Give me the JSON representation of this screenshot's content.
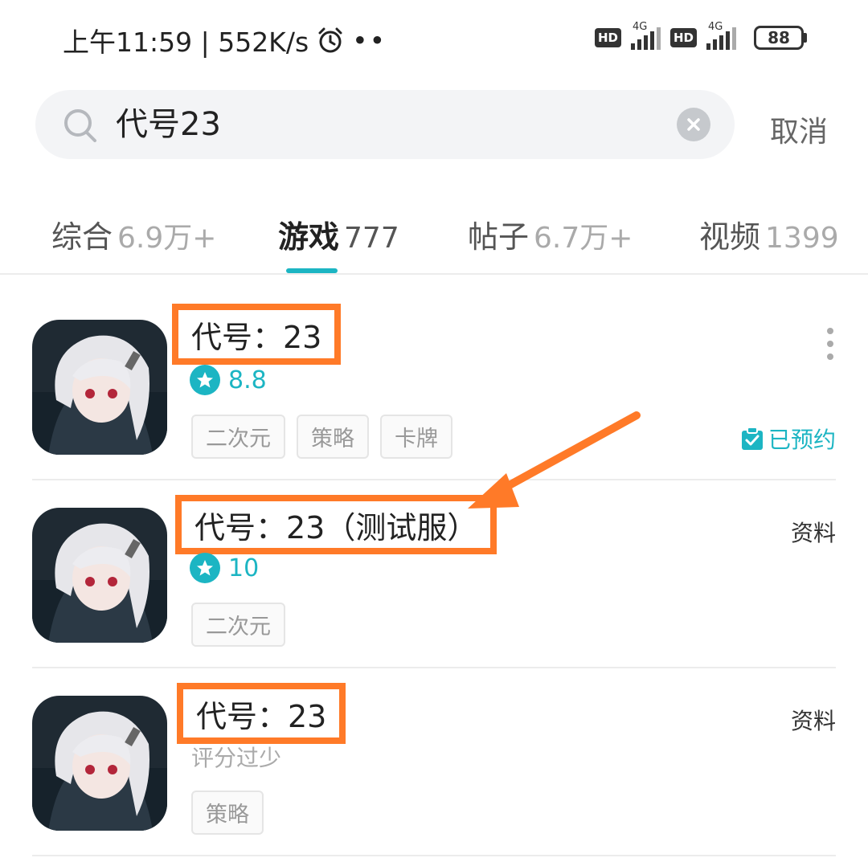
{
  "status_bar": {
    "time": "上午11:59 | 552K/s",
    "dots": "••",
    "hd1": "HD",
    "sig1": "4G",
    "hd2": "HD",
    "sig2": "4G",
    "battery": "88"
  },
  "search": {
    "value": "代号23",
    "cancel_label": "取消"
  },
  "tabs": [
    {
      "name": "综合",
      "count": "6.9万+"
    },
    {
      "name": "游戏",
      "count": "777"
    },
    {
      "name": "帖子",
      "count": "6.7万+"
    },
    {
      "name": "视频",
      "count": "1399"
    }
  ],
  "results": [
    {
      "title": "代号：23",
      "rating": "8.8",
      "tags": [
        "二次元",
        "策略",
        "卡牌"
      ],
      "action": "已预约"
    },
    {
      "title": "代号：23（测试服）",
      "rating": "10",
      "tags": [
        "二次元"
      ],
      "action": "资料"
    },
    {
      "title": "代号：23",
      "rating_text": "评分过少",
      "tags": [
        "策略"
      ],
      "action": "资料"
    }
  ],
  "colors": {
    "accent": "#1cb5c3",
    "highlight": "#ff7a28"
  }
}
